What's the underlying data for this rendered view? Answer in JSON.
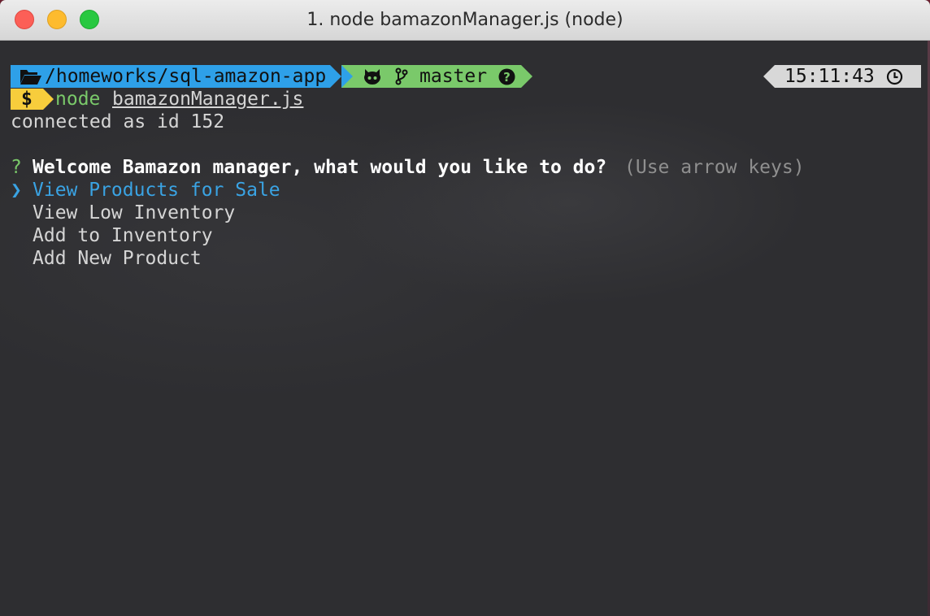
{
  "window": {
    "title": "1. node bamazonManager.js (node)"
  },
  "prompt": {
    "path": "/homeworks/sql-amazon-app",
    "branch": "master",
    "time": "15:11:43",
    "dollar": "$",
    "command": "node",
    "argument": "bamazonManager.js"
  },
  "output": {
    "connected_line": "connected as id 152"
  },
  "question": {
    "mark": "?",
    "text": "Welcome Bamazon manager, what would you like to do?",
    "hint": "(Use arrow keys)",
    "pointer": "❯",
    "options": [
      "View Products for Sale",
      "View Low Inventory",
      "Add to Inventory",
      "Add New Product"
    ],
    "selected_index": 0
  },
  "colors": {
    "path_segment": "#2ea0e8",
    "git_segment": "#7ac96a",
    "time_segment": "#d8d8d8",
    "dollar_segment": "#f7cd3c",
    "selected_option": "#3aa3e3",
    "terminal_bg": "#2e2e31"
  },
  "icons": {
    "folder": "folder-open-icon",
    "github": "github-icon",
    "branch": "git-branch-icon",
    "status": "question-circle-icon",
    "clock": "clock-icon"
  }
}
